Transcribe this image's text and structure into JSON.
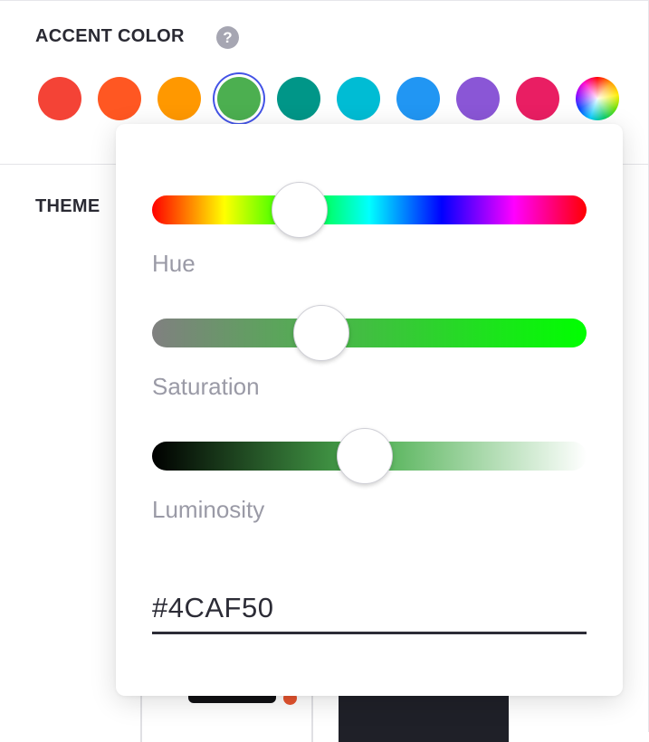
{
  "accent": {
    "title": "ACCENT COLOR",
    "help_icon": "question-mark-icon",
    "swatches": [
      {
        "name": "red",
        "color": "#F44336",
        "selected": false
      },
      {
        "name": "deep-orange",
        "color": "#FF5722",
        "selected": false
      },
      {
        "name": "orange",
        "color": "#FF9800",
        "selected": false
      },
      {
        "name": "green",
        "color": "#4CAF50",
        "selected": true
      },
      {
        "name": "teal",
        "color": "#009688",
        "selected": false
      },
      {
        "name": "cyan",
        "color": "#00BCD4",
        "selected": false
      },
      {
        "name": "blue",
        "color": "#2196F3",
        "selected": false
      },
      {
        "name": "purple",
        "color": "#8A56D6",
        "selected": false
      },
      {
        "name": "pink",
        "color": "#E91E63",
        "selected": false
      },
      {
        "name": "custom",
        "color": "rainbow-gradient",
        "selected": false
      }
    ],
    "selection_ring_color": "#4353E6"
  },
  "theme": {
    "title": "THEME"
  },
  "picker": {
    "hue": {
      "label": "Hue",
      "value_degrees": 122
    },
    "saturation": {
      "label": "Saturation",
      "value_percent": 39
    },
    "luminosity": {
      "label": "Luminosity",
      "value_percent": 49
    },
    "hex_value": "#4CAF50"
  }
}
